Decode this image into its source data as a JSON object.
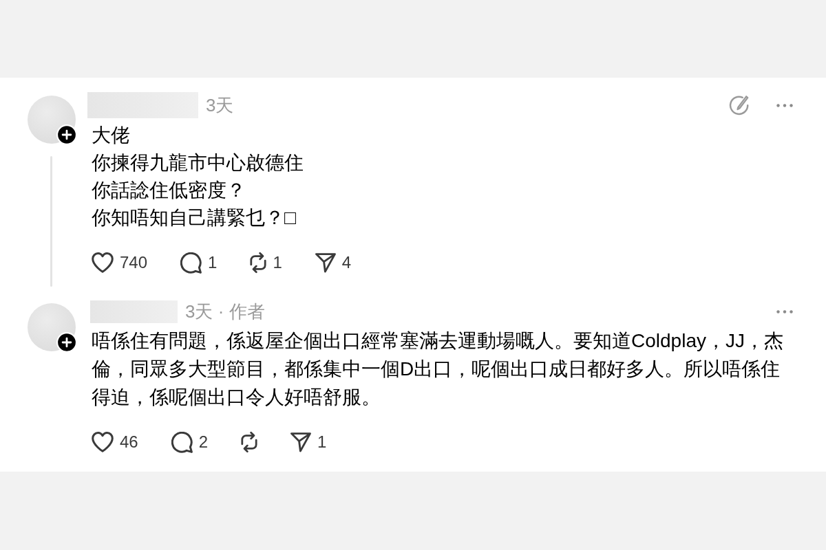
{
  "comments": [
    {
      "meta": "3天",
      "lines": [
        "大佬",
        "你揀得九龍市中心啟德住",
        "你話諗住低密度？",
        "你知唔知自己講緊乜？□"
      ],
      "annotation_icon": true,
      "thread_line": true,
      "actions": [
        {
          "kind": "like",
          "count": "740"
        },
        {
          "kind": "reply",
          "count": "1"
        },
        {
          "kind": "repost",
          "count": "1"
        },
        {
          "kind": "share",
          "count": "4"
        }
      ]
    },
    {
      "meta": "3天 · 作者",
      "lines": [
        "唔係住有問題，係返屋企個出口經常塞滿去運動場嘅人。要知道Coldplay，JJ，杰倫，同眾多大型節目，都係集中一個D出口，呢個出口成日都好多人。所以唔係住得迫，係呢個出口令人好唔舒服。"
      ],
      "annotation_icon": false,
      "thread_line": false,
      "actions": [
        {
          "kind": "like",
          "count": "46"
        },
        {
          "kind": "reply",
          "count": "2"
        },
        {
          "kind": "repost"
        },
        {
          "kind": "share",
          "count": "1"
        }
      ]
    }
  ]
}
